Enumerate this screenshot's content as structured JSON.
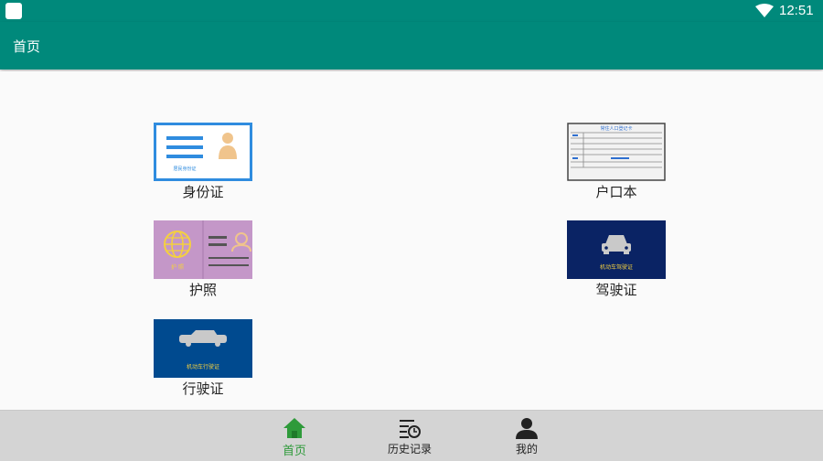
{
  "status_bar": {
    "time": "12:51"
  },
  "app_bar": {
    "title": "首页"
  },
  "cards": [
    {
      "label": "身份证",
      "icon": "id-card-icon",
      "art_text": "居民身份证"
    },
    {
      "label": "户口本",
      "icon": "household-register-icon",
      "art_text": "常住人口登记卡"
    },
    {
      "label": "护照",
      "icon": "passport-icon",
      "art_text": "护 照"
    },
    {
      "label": "驾驶证",
      "icon": "driver-license-icon",
      "art_text": "机动车驾驶证"
    },
    {
      "label": "行驶证",
      "icon": "vehicle-license-icon",
      "art_text": "机动车行驶证"
    }
  ],
  "bottom_nav": [
    {
      "label": "首页",
      "icon": "home-icon",
      "active": true
    },
    {
      "label": "历史记录",
      "icon": "history-icon",
      "active": false
    },
    {
      "label": "我的",
      "icon": "profile-icon",
      "active": false
    }
  ],
  "colors": {
    "primary": "#00897b",
    "nav_active": "#2e9a3a",
    "nav_bg": "#d4d4d4"
  }
}
